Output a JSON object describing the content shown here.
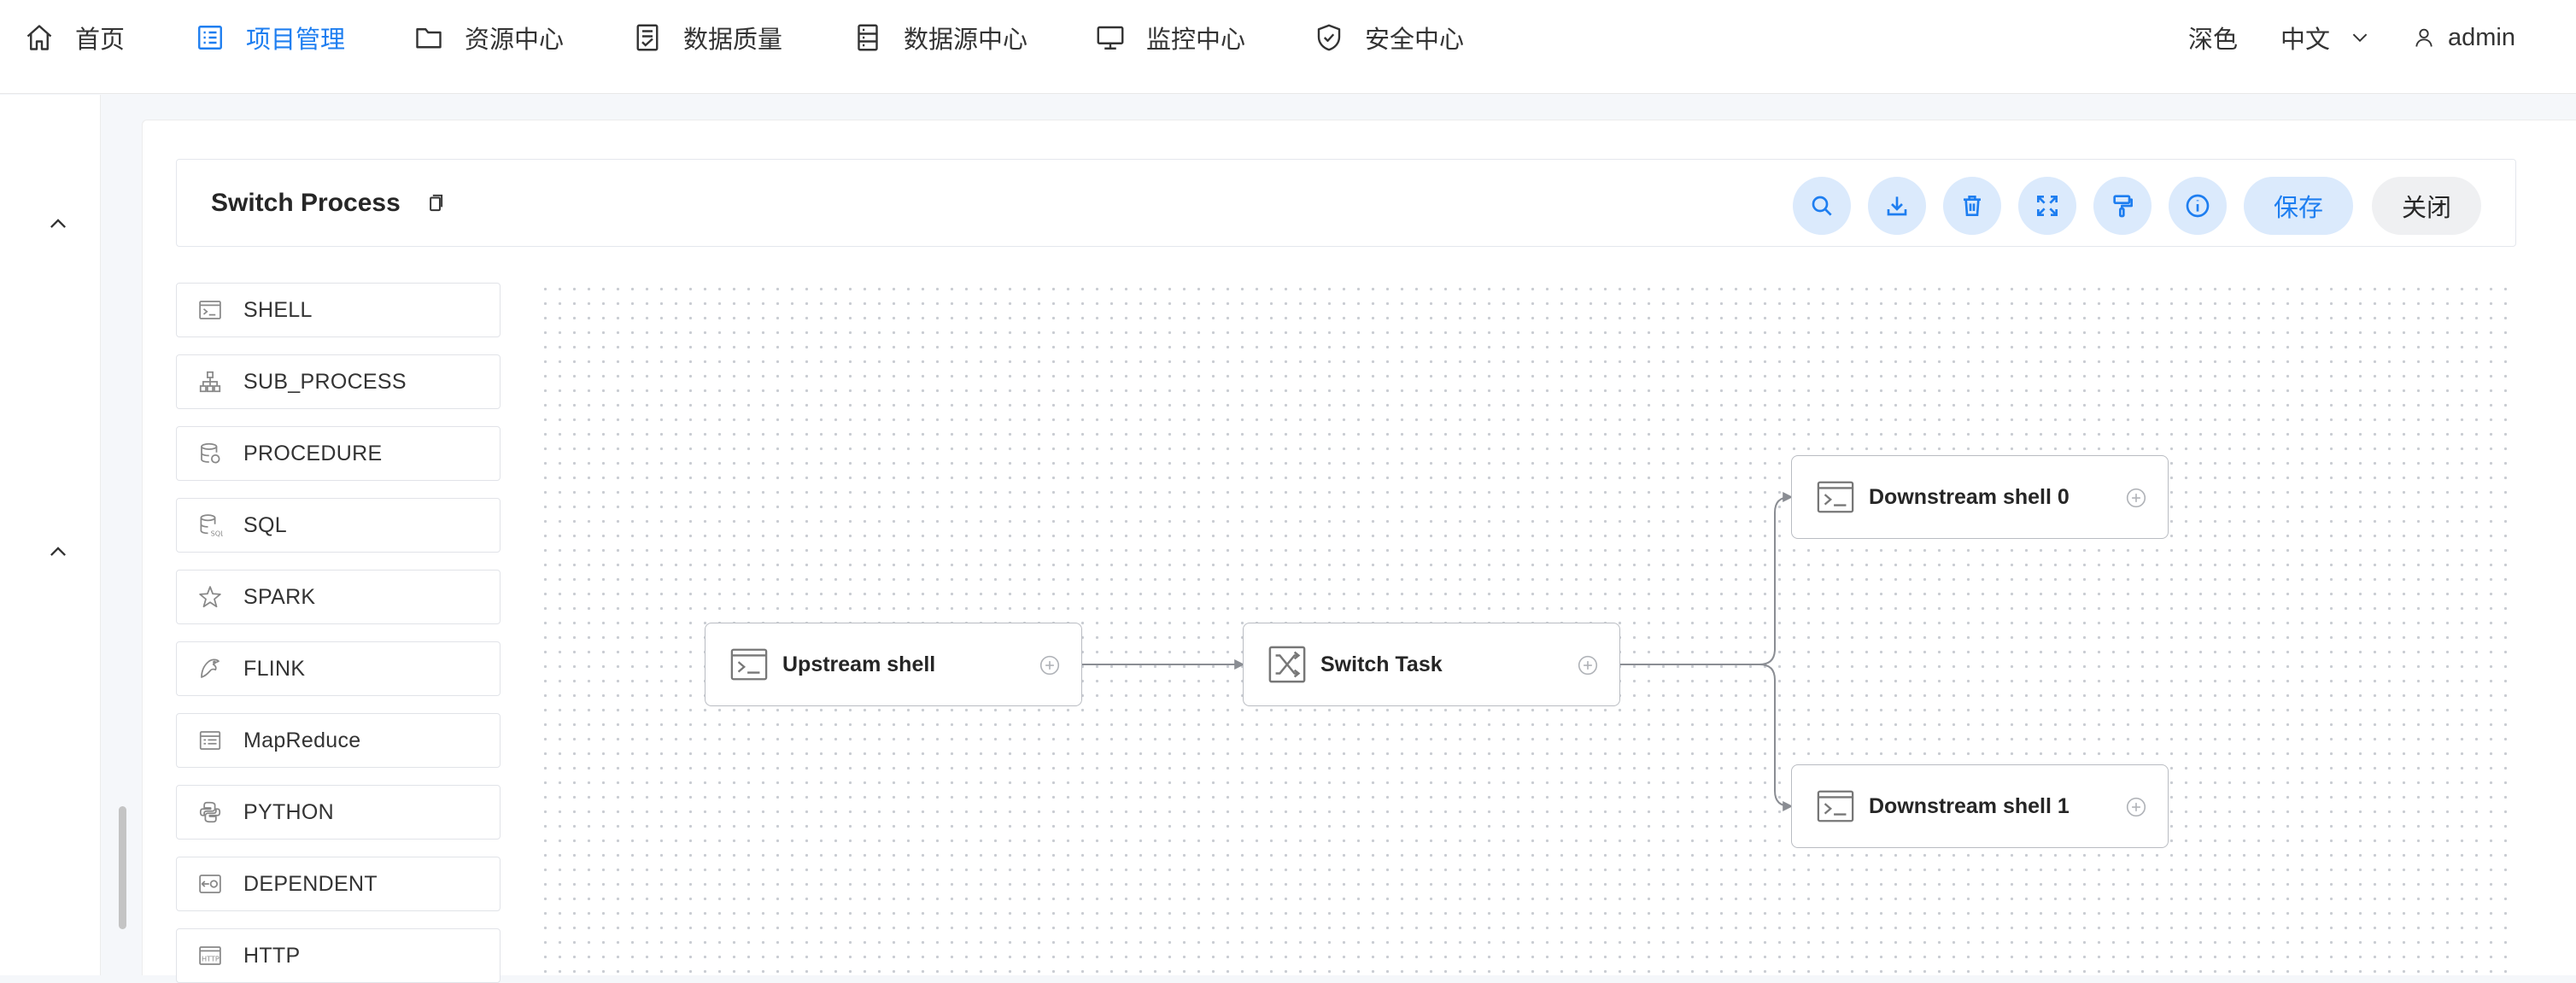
{
  "nav": {
    "items": [
      {
        "label": "首页",
        "icon": "home-icon",
        "active": false
      },
      {
        "label": "项目管理",
        "icon": "project-list-icon",
        "active": true
      },
      {
        "label": "资源中心",
        "icon": "folder-icon",
        "active": false
      },
      {
        "label": "数据质量",
        "icon": "document-check-icon",
        "active": false
      },
      {
        "label": "数据源中心",
        "icon": "server-icon",
        "active": false
      },
      {
        "label": "监控中心",
        "icon": "monitor-icon",
        "active": false
      },
      {
        "label": "安全中心",
        "icon": "shield-check-icon",
        "active": false
      }
    ],
    "theme_label": "深色",
    "language_label": "中文",
    "user_label": "admin",
    "accent_color": "#1e7ef0"
  },
  "toolbar": {
    "title": "Switch Process",
    "icons": [
      "search-icon",
      "download-icon",
      "delete-icon",
      "fullscreen-icon",
      "format-brush-icon",
      "info-icon"
    ],
    "save_label": "保存",
    "close_label": "关闭"
  },
  "palette": {
    "items": [
      {
        "label": "SHELL",
        "icon": "shell-icon"
      },
      {
        "label": "SUB_PROCESS",
        "icon": "sub-process-icon"
      },
      {
        "label": "PROCEDURE",
        "icon": "procedure-icon"
      },
      {
        "label": "SQL",
        "icon": "sql-icon"
      },
      {
        "label": "SPARK",
        "icon": "spark-icon"
      },
      {
        "label": "FLINK",
        "icon": "flink-icon"
      },
      {
        "label": "MapReduce",
        "icon": "mapreduce-icon"
      },
      {
        "label": "PYTHON",
        "icon": "python-icon"
      },
      {
        "label": "DEPENDENT",
        "icon": "dependent-icon"
      },
      {
        "label": "HTTP",
        "icon": "http-icon"
      }
    ]
  },
  "dag": {
    "nodes": [
      {
        "id": "upstream",
        "label": "Upstream shell",
        "icon": "shell-icon"
      },
      {
        "id": "switch",
        "label": "Switch Task",
        "icon": "switch-icon"
      },
      {
        "id": "down0",
        "label": "Downstream shell 0",
        "icon": "shell-icon"
      },
      {
        "id": "down1",
        "label": "Downstream shell 1",
        "icon": "shell-icon"
      }
    ],
    "edges": [
      {
        "from": "upstream",
        "to": "switch"
      },
      {
        "from": "switch",
        "to": "down0"
      },
      {
        "from": "switch",
        "to": "down1"
      }
    ]
  }
}
